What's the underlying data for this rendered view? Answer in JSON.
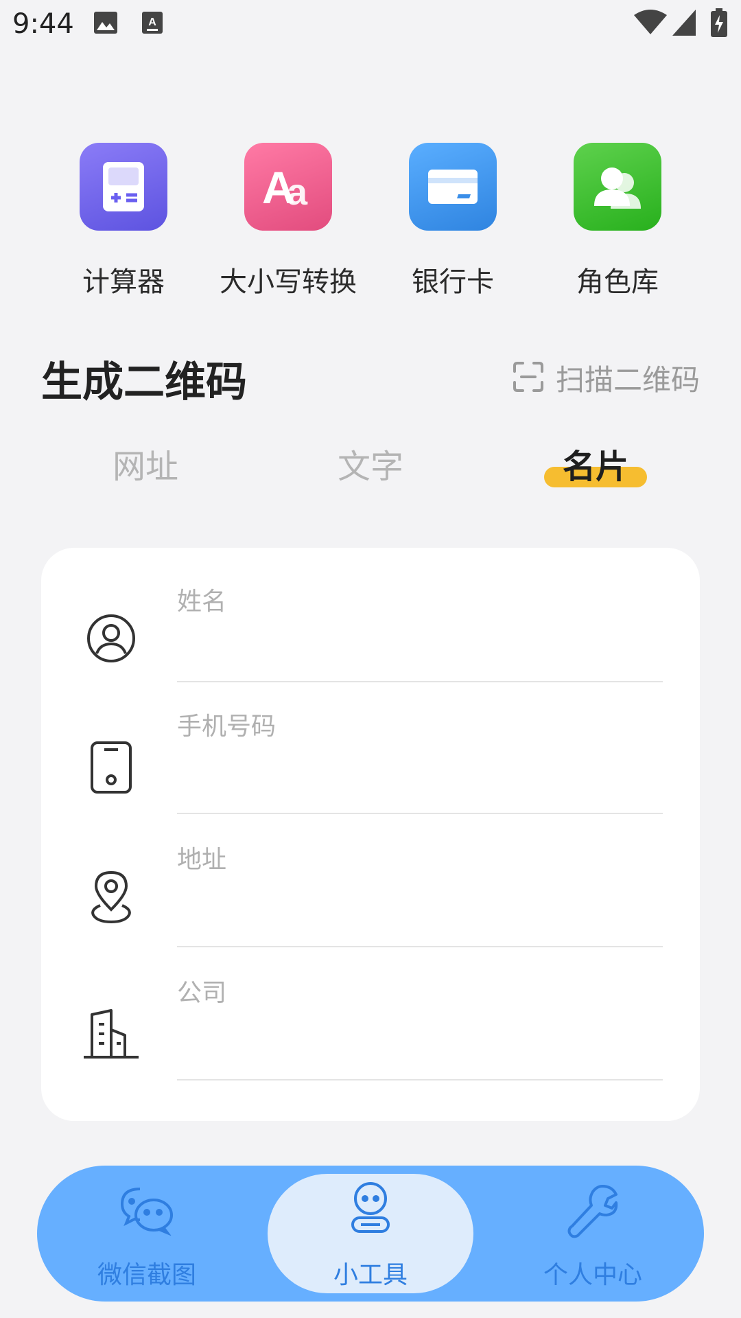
{
  "status_bar": {
    "time": "9:44",
    "icons": [
      "image-icon",
      "keyboard-a-icon",
      "wifi-icon",
      "signal-icon",
      "battery-charging-icon"
    ]
  },
  "tools": [
    {
      "label": "计算器",
      "icon": "calculator-icon",
      "color": "#7165f0"
    },
    {
      "label": "大小写转换",
      "icon": "text-case-icon",
      "color": "#ee5c8c"
    },
    {
      "label": "银行卡",
      "icon": "bank-card-icon",
      "color": "#3f95ec"
    },
    {
      "label": "角色库",
      "icon": "characters-icon",
      "color": "#37c22a"
    }
  ],
  "section": {
    "title": "生成二维码",
    "scan_label": "扫描二维码"
  },
  "tabs": [
    {
      "label": "网址",
      "active": false
    },
    {
      "label": "文字",
      "active": false
    },
    {
      "label": "名片",
      "active": true
    }
  ],
  "accent_color": "#f6bd30",
  "form": {
    "fields": [
      {
        "placeholder": "姓名",
        "icon": "user-circle-icon"
      },
      {
        "placeholder": "手机号码",
        "icon": "phone-icon"
      },
      {
        "placeholder": "地址",
        "icon": "location-pin-icon"
      },
      {
        "placeholder": "公司",
        "icon": "building-icon"
      }
    ]
  },
  "bottom_nav": {
    "items": [
      {
        "label": "微信截图",
        "icon": "wechat-chat-icon",
        "active": false
      },
      {
        "label": "小工具",
        "icon": "robot-tools-icon",
        "active": true
      },
      {
        "label": "个人中心",
        "icon": "wrench-icon",
        "active": false
      }
    ],
    "bar_color": "#66afff"
  }
}
